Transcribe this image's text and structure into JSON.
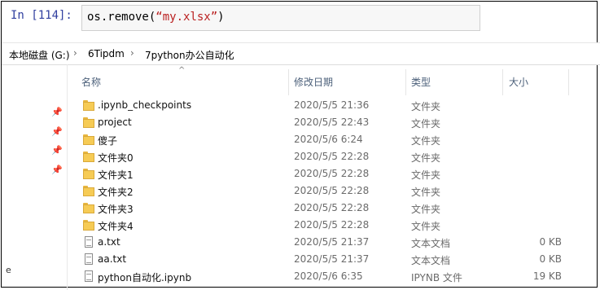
{
  "notebook": {
    "prompt": "In [114]:",
    "code_prefix": "os.remove(",
    "code_string": "“my.xlsx”",
    "code_suffix": ")"
  },
  "breadcrumb": {
    "items": [
      "本地磁盘 (G:)",
      "6Tipdm",
      "7python办公自动化"
    ],
    "separator": "›"
  },
  "sidebar": {
    "pins": [
      "pin",
      "pin",
      "pin",
      "pin"
    ],
    "fragment": "e"
  },
  "columns": {
    "name": "名称",
    "date": "修改日期",
    "type": "类型",
    "size": "大小",
    "sort_indicator": "^"
  },
  "files": [
    {
      "name": ".ipynb_checkpoints",
      "date": "2020/5/5 21:36",
      "type": "文件夹",
      "size": "",
      "icon": "folder-icon"
    },
    {
      "name": "project",
      "date": "2020/5/5 22:43",
      "type": "文件夹",
      "size": "",
      "icon": "folder-icon"
    },
    {
      "name": "傻子",
      "date": "2020/5/6 6:24",
      "type": "文件夹",
      "size": "",
      "icon": "folder-icon"
    },
    {
      "name": "文件夹0",
      "date": "2020/5/5 22:28",
      "type": "文件夹",
      "size": "",
      "icon": "folder-icon"
    },
    {
      "name": "文件夹1",
      "date": "2020/5/5 22:28",
      "type": "文件夹",
      "size": "",
      "icon": "folder-icon"
    },
    {
      "name": "文件夹2",
      "date": "2020/5/5 22:28",
      "type": "文件夹",
      "size": "",
      "icon": "folder-icon"
    },
    {
      "name": "文件夹3",
      "date": "2020/5/5 22:28",
      "type": "文件夹",
      "size": "",
      "icon": "folder-icon"
    },
    {
      "name": "文件夹4",
      "date": "2020/5/5 22:28",
      "type": "文件夹",
      "size": "",
      "icon": "folder-icon"
    },
    {
      "name": "a.txt",
      "date": "2020/5/5 21:37",
      "type": "文本文档",
      "size": "0 KB",
      "icon": "text-file-icon"
    },
    {
      "name": "aa.txt",
      "date": "2020/5/5 21:37",
      "type": "文本文档",
      "size": "0 KB",
      "icon": "text-file-icon"
    },
    {
      "name": "python自动化.ipynb",
      "date": "2020/5/6 6:35",
      "type": "IPYNB 文件",
      "size": "19 KB",
      "icon": "file-icon"
    }
  ]
}
